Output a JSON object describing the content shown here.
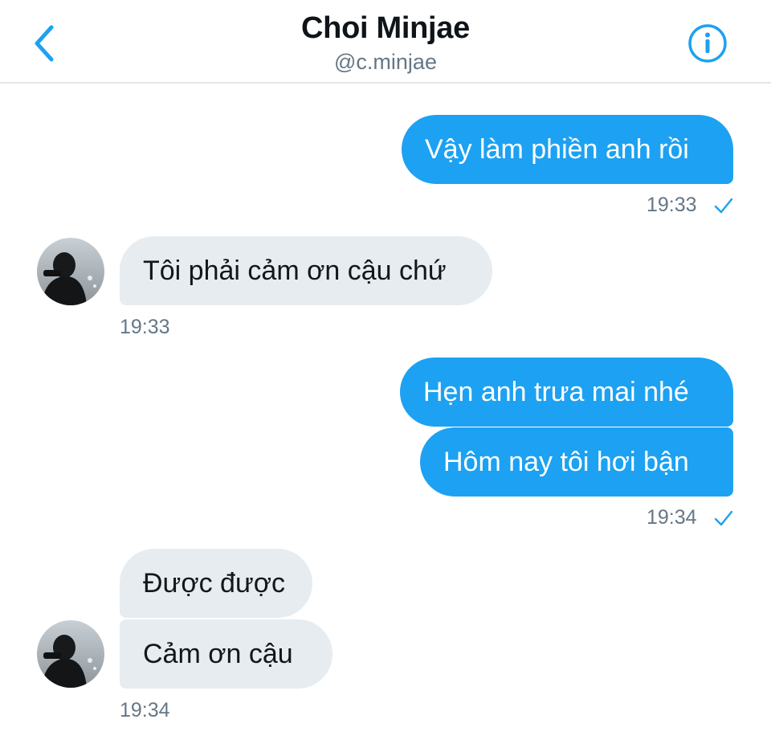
{
  "header": {
    "name": "Choi Minjae",
    "handle": "@c.minjae",
    "back_icon": "chevron-left-icon",
    "info_icon": "info-circle-icon"
  },
  "colors": {
    "accent": "#1da1f2",
    "incoming_bubble": "#e6ecf0",
    "timestamp": "#657786"
  },
  "messages": [
    {
      "direction": "outgoing",
      "text": "Vậy làm phiền anh rồi"
    },
    {
      "direction": "outgoing",
      "time": "19:33",
      "status_icon": "check-icon"
    },
    {
      "direction": "incoming",
      "text": "Tôi phải cảm ơn cậu chứ"
    },
    {
      "direction": "incoming",
      "time": "19:33"
    },
    {
      "direction": "outgoing",
      "text": "Hẹn anh trưa mai nhé"
    },
    {
      "direction": "outgoing",
      "text": "Hôm nay tôi hơi bận"
    },
    {
      "direction": "outgoing",
      "time": "19:34",
      "status_icon": "check-icon"
    },
    {
      "direction": "incoming",
      "text": "Được được"
    },
    {
      "direction": "incoming",
      "text": "Cảm ơn cậu"
    },
    {
      "direction": "incoming",
      "time": "19:34"
    }
  ]
}
